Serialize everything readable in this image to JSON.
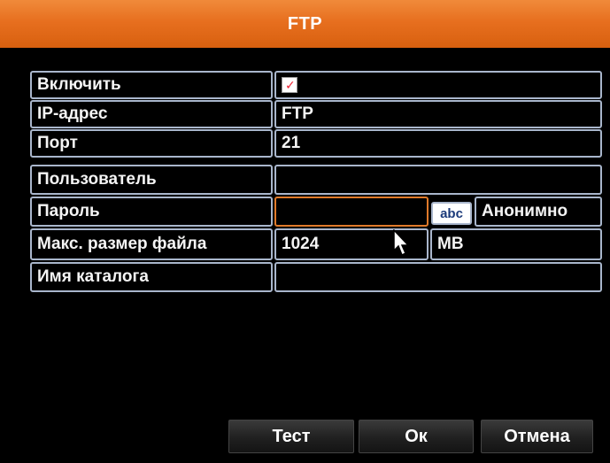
{
  "window": {
    "title": "FTP"
  },
  "rows": {
    "enable": {
      "label": "Включить",
      "checked": true
    },
    "ip": {
      "label": "IP-адрес",
      "value": "FTP"
    },
    "port": {
      "label": "Порт",
      "value": "21"
    },
    "user": {
      "label": "Пользователь",
      "value": ""
    },
    "password": {
      "label": "Пароль",
      "value": "",
      "keyboard_badge": "abc",
      "anonymous_label": "Анонимно"
    },
    "max_size": {
      "label": "Макс. размер файла",
      "value": "1024",
      "unit": "MB"
    },
    "dir": {
      "label": "Имя каталога",
      "value": ""
    }
  },
  "buttons": {
    "test": "Тест",
    "ok": "Ок",
    "cancel": "Отмена"
  },
  "colors": {
    "title_bar": "#e76f1f",
    "cell_border": "#a9b6cc",
    "focus_border": "#e07a2a",
    "background": "#000000"
  },
  "icons": {
    "cursor": "mouse-pointer-icon",
    "checkbox": "checkbox-checked-icon"
  }
}
